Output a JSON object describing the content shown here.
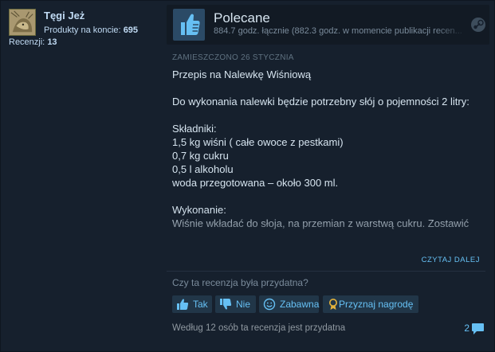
{
  "author": {
    "name": "Tęgi Jeż",
    "products_label": "Produkty na koncie:",
    "products_count": "695",
    "reviews_label": "Recenzji:",
    "reviews_count": "13"
  },
  "review": {
    "vote": "Polecane",
    "hours": "884.7 godz. łącznie (882.3 godz. w momencie publikacji recen...",
    "posted": "Zamieszczono 26 stycznia",
    "body": "Przepis na Nalewkę Wiśniową\n\nDo wykonania nalewki będzie potrzebny słój o pojemności 2 litry:\n\nSkładniki:\n1,5 kg wiśni ( całe owoce z pestkami)\n0,7 kg cukru\n0,5 l alkoholu\nwoda przegotowana – około 300 ml.\n\nWykonanie:\nWiśnie wkładać do słoja, na przemian z warstwą cukru. Zostawić",
    "read_more": "Czytaj dalej"
  },
  "feedback": {
    "question": "Czy ta recenzja była przydatna?",
    "yes": "Tak",
    "no": "Nie",
    "funny": "Zabawna",
    "award": "Przyznaj nagrodę",
    "helpful_text": "Według 12 osób ta recenzja jest przydatna",
    "comments": "2"
  },
  "colors": {
    "background": "#16202d",
    "accent": "#66c0f4",
    "author_name": "#c1dbf4",
    "thumb_box": "#2b4a66"
  },
  "icons": {
    "vote": "thumbs-up-icon",
    "platform": "steam-icon",
    "yes": "thumbs-up-icon",
    "no": "thumbs-down-icon",
    "funny": "smiley-icon",
    "award": "award-icon",
    "comments": "comment-bubble-icon"
  }
}
